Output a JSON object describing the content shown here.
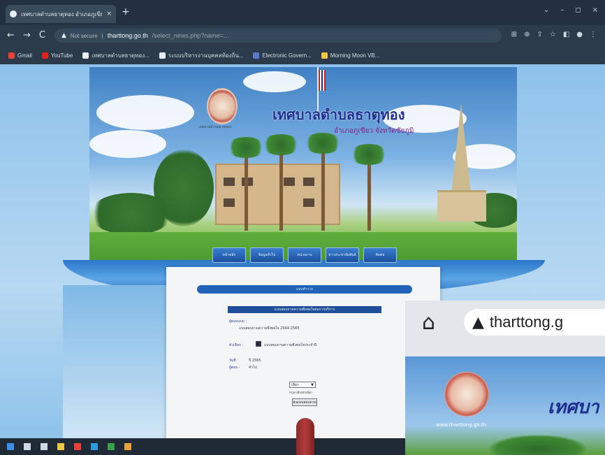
{
  "browser": {
    "tab_title": "เทศบาลตำบลธาตุทอง อำเภอภูเขียว จั...",
    "tab_close": "×",
    "new_tab": "+",
    "window_controls": [
      "⌄",
      "–",
      "◻",
      "×"
    ],
    "nav": {
      "back": "←",
      "forward": "→",
      "reload": "C"
    },
    "address": {
      "warning_icon": "warning-triangle-icon",
      "not_secure": "Not secure",
      "host": "tharttong.go.th",
      "path": "/select_news.php?name=..."
    },
    "bookmarks": [
      {
        "label": "Gmail",
        "color": "#e94235"
      },
      {
        "label": "YouTube",
        "color": "#e62117"
      },
      {
        "label": "เทศบาลตำบลธาตุทอง...",
        "color": "#e9eef2"
      },
      {
        "label": "ระบบบริหารงานบุคคลท้องถิ่น...",
        "color": "#e9eef2"
      },
      {
        "label": "Electronic Govern...",
        "color": "#5b7ac8"
      },
      {
        "label": "Morning Moon VB...",
        "color": "#f2c744"
      }
    ]
  },
  "website": {
    "title": "เทศบาลตำบลธาตุทอง",
    "subtitle": "อำเภอภูเขียว จังหวัดชัยภูมิ",
    "seal_caption": "เทศบาลตำบลธาตุทอง",
    "menu": [
      "หน้าหลัก",
      "ข้อมูลทั่วไป",
      "หน่วยงาน",
      "ข่าวประชาสัมพันธ์",
      "ติดต่อ"
    ]
  },
  "popup": {
    "header": "แบบสำรวจ",
    "form_title": "แบบสอบถามความพึงพอใจต่อการบริการ",
    "fields": [
      {
        "label": "ผู้ตอบแบบ :",
        "value": "แบบสอบถามความพึงพอใจ 2564-2565"
      },
      {
        "label": "ตัวเลือก :",
        "value": "แบบสอบถามความพึงพอใจประจำปี"
      },
      {
        "label": "วันที่ :",
        "value": "ปี 2565"
      },
      {
        "label": "ผู้ตอบ :",
        "value": "ทั่วไป"
      }
    ],
    "select_value": "เลือก",
    "select_caret": "▼",
    "note": "กรุณาเลือกตัวเลือก",
    "submit_label": "ส่งแบบสอบถาม"
  },
  "zoom_inset": {
    "home_icon": "home-icon",
    "url": "tharttong.g",
    "page_title": "เทศบา",
    "seal_caption": "www.tharttong.go.th"
  },
  "taskbar": {
    "icons": [
      {
        "name": "windows-start-icon",
        "color": "#3d8ee6"
      },
      {
        "name": "search-icon",
        "color": "#cfd8e0"
      },
      {
        "name": "task-view-icon",
        "color": "#cfd8e0"
      },
      {
        "name": "file-explorer-icon",
        "color": "#f2c744"
      },
      {
        "name": "chrome-icon",
        "color": "#e94235"
      },
      {
        "name": "edge-icon",
        "color": "#2c9be0"
      },
      {
        "name": "app-icon",
        "color": "#3aa14a"
      },
      {
        "name": "app-icon-2",
        "color": "#e9a23a"
      }
    ]
  }
}
